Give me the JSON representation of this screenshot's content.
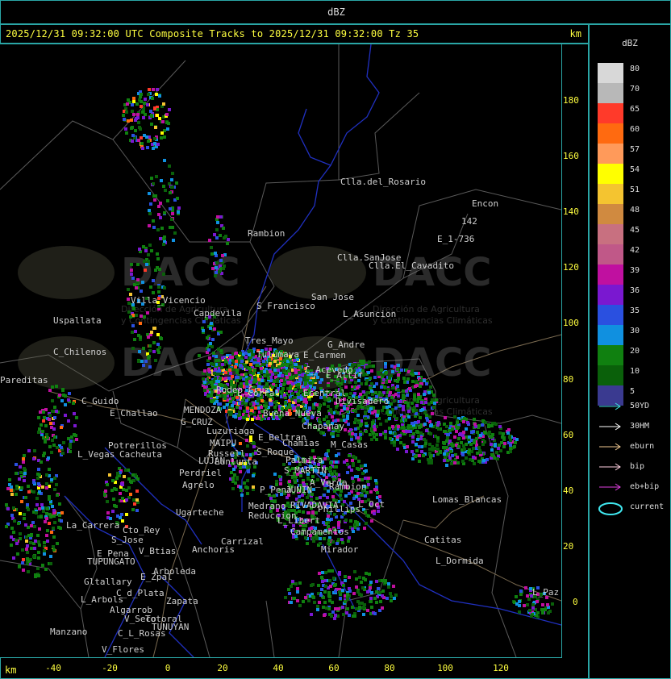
{
  "window": {
    "top_title": "dBZ"
  },
  "header": {
    "title": "2025/12/31 09:32:00 UTC Composite Tracks to 2025/12/31 09:32:00 Tz 35",
    "unit": "km"
  },
  "axes": {
    "y_ticks": [
      "180",
      "160",
      "140",
      "120",
      "100",
      "80",
      "60",
      "40",
      "20",
      "0"
    ],
    "x_ticks": [
      "-40",
      "-20",
      "0",
      "20",
      "40",
      "60",
      "80",
      "100",
      "120"
    ],
    "x_unit": "km"
  },
  "watermark": {
    "brand": "DACC",
    "line1": "Dirección de Agricultura",
    "line2": "y Contingencias Climáticas"
  },
  "places": [
    "Clla.del_Rosario",
    "Encon",
    "142",
    "E_1-736",
    "Rambion",
    "Clla.SanJose",
    "Clla.El_Cavadito",
    "Villa_Vicencio",
    "Capdevila",
    "S_Francisco",
    "San Jose",
    "L_Asuncion",
    "Uspallata",
    "Tres_Mayo",
    "G_Andre",
    "C_Chilenos",
    "Tulumaya",
    "E_Carmen",
    "C_Acevedo",
    "E_Altif",
    "Rodeo_Cruz",
    "L_Corral",
    "Ecentral",
    "Divisadero",
    "C_Guido",
    "E_Challao",
    "MENDOZA",
    "G_CRUZ",
    "Luzuriaga",
    "Buena_Nueva",
    "Chapanay",
    "E_Beltran",
    "Chamias",
    "M_Casas",
    "S_Roque",
    "Palmira",
    "Potrerillos",
    "L_Vegas",
    "Cacheuta",
    "MAIPU",
    "Russell",
    "LUJAN",
    "Lunlunta",
    "S_MARTIN",
    "Perdriel",
    "Agrelo",
    "A_Verde",
    "Rambion",
    "P_Pena",
    "JUNIN",
    "Ugarteche",
    "Medrano",
    "Reduccion",
    "RIVADAVIA",
    "Phillips",
    "Lomas_Blancas",
    "L_Oct",
    "La_Carrera",
    "Cto_Rey",
    "S_Jose",
    "L_Libert",
    "Campamentos",
    "Catitas",
    "E_Pena",
    "V_Btias",
    "Anchoris",
    "Carrizal",
    "Mirador",
    "L_Dormida",
    "TUPUNGATO",
    "Arboleda",
    "Gltallary",
    "E_Zpal",
    "C_d_Plata",
    "L_Arbols",
    "Zapata",
    "Algarrob",
    "V_Seco",
    "Totoral",
    "TUNUYAN",
    "Manzano",
    "C_L_Rosas",
    "V_Flores",
    "Pareditas",
    "L_Paz"
  ],
  "legend": {
    "title": "dBZ",
    "scale": [
      {
        "label": "80",
        "color": "#d8d8d8"
      },
      {
        "label": "70",
        "color": "#b8b8b8"
      },
      {
        "label": "65",
        "color": "#ff3a2a"
      },
      {
        "label": "60",
        "color": "#ff6a10"
      },
      {
        "label": "57",
        "color": "#ff9a5a"
      },
      {
        "label": "54",
        "color": "#ffff00"
      },
      {
        "label": "51",
        "color": "#f4c430"
      },
      {
        "label": "48",
        "color": "#d08a40"
      },
      {
        "label": "45",
        "color": "#c87080"
      },
      {
        "label": "42",
        "color": "#c05888"
      },
      {
        "label": "39",
        "color": "#c010a0"
      },
      {
        "label": "36",
        "color": "#7a18d0"
      },
      {
        "label": "35",
        "color": "#2a50e0"
      },
      {
        "label": "30",
        "color": "#1090e0"
      },
      {
        "label": "20",
        "color": "#108010"
      },
      {
        "label": "10",
        "color": "#0a600a"
      },
      {
        "label": "5",
        "color": "#3a3a90"
      }
    ],
    "tracks": [
      {
        "label": "50YD",
        "color": "#40e0e0"
      },
      {
        "label": "30HM",
        "color": "#ffffff"
      },
      {
        "label": "eburn",
        "color": "#f0c890"
      },
      {
        "label": "bip",
        "color": "#ffd0e0"
      },
      {
        "label": "eb+bip",
        "color": "#e040e0"
      },
      {
        "label": "current",
        "color": "#40e8f0"
      }
    ]
  }
}
